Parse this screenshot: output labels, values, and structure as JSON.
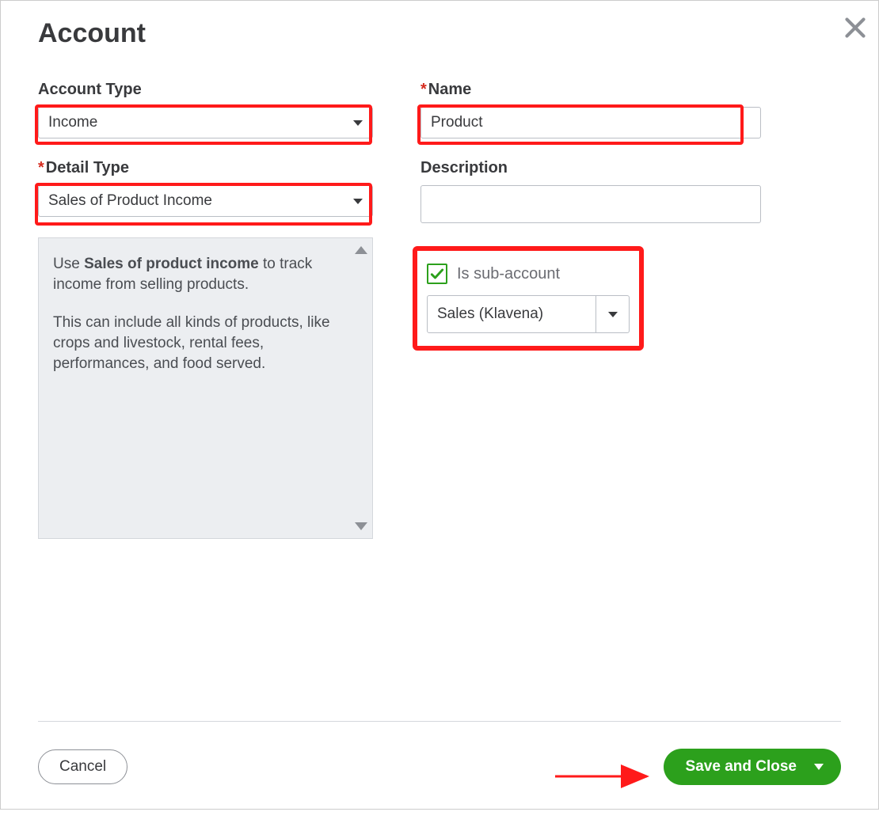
{
  "header": {
    "title": "Account"
  },
  "fields": {
    "account_type": {
      "label": "Account Type",
      "value": "Income"
    },
    "detail_type": {
      "label": "Detail Type",
      "value": "Sales of Product Income"
    },
    "name": {
      "label": "Name",
      "value": "Product"
    },
    "description": {
      "label": "Description",
      "value": ""
    }
  },
  "help": {
    "part1": "Use ",
    "bold": "Sales of product income",
    "part2": " to track income from selling products.",
    "para2": "This can include all kinds of products, like crops and livestock, rental fees, performances, and food served."
  },
  "sub_account": {
    "checkbox_label": "Is sub-account",
    "checked": true,
    "parent_value": "Sales (Klavena)"
  },
  "footer": {
    "cancel_label": "Cancel",
    "save_label": "Save and Close"
  }
}
